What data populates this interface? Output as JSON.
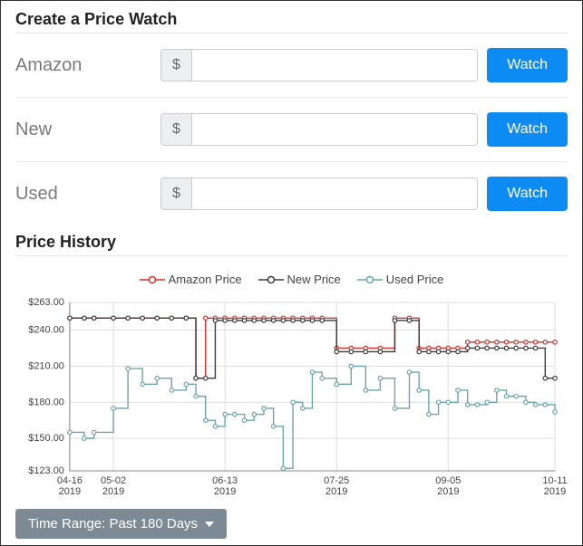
{
  "createWatch": {
    "title": "Create a Price Watch",
    "rows": [
      {
        "label": "Amazon",
        "prefix": "$",
        "value": "",
        "button": "Watch"
      },
      {
        "label": "New",
        "prefix": "$",
        "value": "",
        "button": "Watch"
      },
      {
        "label": "Used",
        "prefix": "$",
        "value": "",
        "button": "Watch"
      }
    ]
  },
  "history": {
    "title": "Price History",
    "legend": [
      {
        "name": "Amazon Price",
        "color": "#d6302b"
      },
      {
        "name": "New Price",
        "color": "#3b3b3b"
      },
      {
        "name": "Used Price",
        "color": "#6aa5ad"
      }
    ],
    "timeRange": "Time Range: Past 180 Days"
  },
  "chart_data": {
    "type": "line",
    "xlabel": "",
    "ylabel": "",
    "ylim": [
      123,
      263
    ],
    "y_ticks": [
      263.0,
      240.0,
      210.0,
      180.0,
      150.0,
      123.0
    ],
    "x_ticks": [
      "04-16\n2019",
      "05-02\n2019",
      "06-13\n2019",
      "07-25\n2019",
      "09-05\n2019",
      "10-11\n2019"
    ],
    "x_tick_positions": [
      0,
      9,
      32,
      55,
      78,
      100
    ],
    "x": [
      0,
      3,
      5,
      9,
      12,
      15,
      18,
      21,
      24,
      26,
      28,
      30,
      32,
      34,
      36,
      38,
      40,
      42,
      44,
      46,
      48,
      50,
      52,
      55,
      58,
      61,
      64,
      67,
      70,
      72,
      74,
      76,
      78,
      80,
      82,
      84,
      86,
      88,
      90,
      92,
      94,
      96,
      98,
      100
    ],
    "series": [
      {
        "name": "Amazon Price",
        "color": "#d6302b",
        "values": [
          250,
          250,
          250,
          250,
          250,
          250,
          250,
          250,
          250,
          200,
          250,
          250,
          250,
          250,
          250,
          250,
          250,
          250,
          250,
          250,
          250,
          250,
          250,
          225,
          225,
          225,
          225,
          250,
          250,
          225,
          225,
          225,
          225,
          225,
          230,
          230,
          230,
          230,
          230,
          230,
          230,
          230,
          230,
          230
        ]
      },
      {
        "name": "New Price",
        "color": "#3b3b3b",
        "values": [
          250,
          250,
          250,
          250,
          250,
          250,
          250,
          250,
          250,
          200,
          200,
          248,
          248,
          248,
          248,
          248,
          248,
          248,
          248,
          248,
          248,
          248,
          248,
          222,
          222,
          222,
          222,
          248,
          248,
          222,
          222,
          222,
          222,
          222,
          225,
          225,
          225,
          225,
          225,
          225,
          225,
          225,
          200,
          200
        ]
      },
      {
        "name": "Used Price",
        "color": "#6aa5ad",
        "values": [
          155,
          150,
          155,
          175,
          208,
          195,
          200,
          190,
          195,
          185,
          165,
          160,
          170,
          170,
          165,
          170,
          175,
          160,
          125,
          180,
          175,
          205,
          200,
          195,
          210,
          190,
          200,
          175,
          205,
          190,
          170,
          180,
          180,
          190,
          178,
          178,
          180,
          190,
          185,
          185,
          180,
          178,
          178,
          172
        ]
      }
    ]
  }
}
